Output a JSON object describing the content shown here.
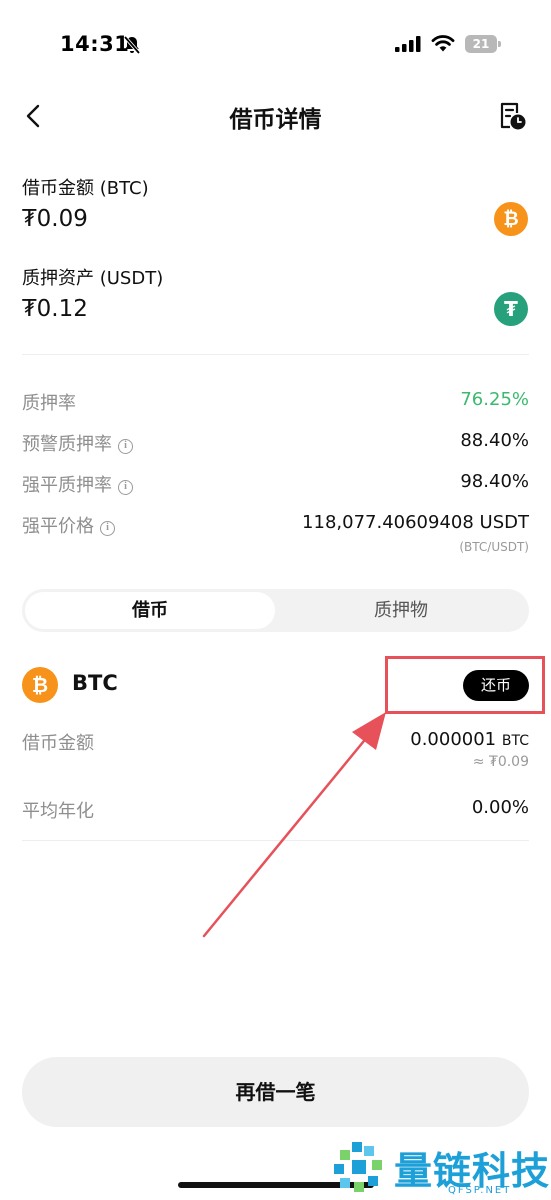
{
  "status_bar": {
    "time": "14:31",
    "battery_level": "21",
    "icons": [
      "bell-off-icon",
      "signal-icon",
      "wifi-icon",
      "battery-icon"
    ]
  },
  "header": {
    "title": "借币详情",
    "icons": [
      "chevron-left-icon",
      "order-history-icon"
    ]
  },
  "assets": {
    "borrowed": {
      "label": "借币金额 (BTC)",
      "value": "₮0.09",
      "icon": "btc-icon",
      "glyph": "₿"
    },
    "collateral": {
      "label": "质押资产 (USDT)",
      "value": "₮0.12",
      "icon": "usdt-icon",
      "glyph": "₮"
    }
  },
  "stats": {
    "collateral_ratio": {
      "label": "质押率",
      "value": "76.25%"
    },
    "warning_ratio": {
      "label": "预警质押率",
      "value": "88.40%"
    },
    "liquidation_ratio": {
      "label": "强平质押率",
      "value": "98.40%"
    },
    "liquidation_price": {
      "label": "强平价格",
      "value": "118,077.40609408 USDT",
      "sub": "(BTC/USDT)"
    },
    "info_glyph": "i"
  },
  "tabs": [
    {
      "label": "借币",
      "active": true
    },
    {
      "label": "质押物",
      "active": false
    }
  ],
  "loan": {
    "coin": "BTC",
    "coin_glyph": "₿",
    "repay_label": "还币",
    "amount": {
      "label": "借币金额",
      "value": "0.000001",
      "unit": "BTC",
      "sub": "≈ ₮0.09"
    },
    "apr": {
      "label": "平均年化",
      "value": "0.00%"
    }
  },
  "footer": {
    "borrow_again_label": "再借一笔"
  },
  "watermark": {
    "name": "量链科技",
    "domain": "QFSP.NET"
  },
  "colors": {
    "accent_green": "#3cb96f",
    "btc_orange": "#f7931a",
    "usdt_green": "#26a17b",
    "annotation_red": "#e7515a",
    "watermark_blue": "#1d9fd8"
  }
}
